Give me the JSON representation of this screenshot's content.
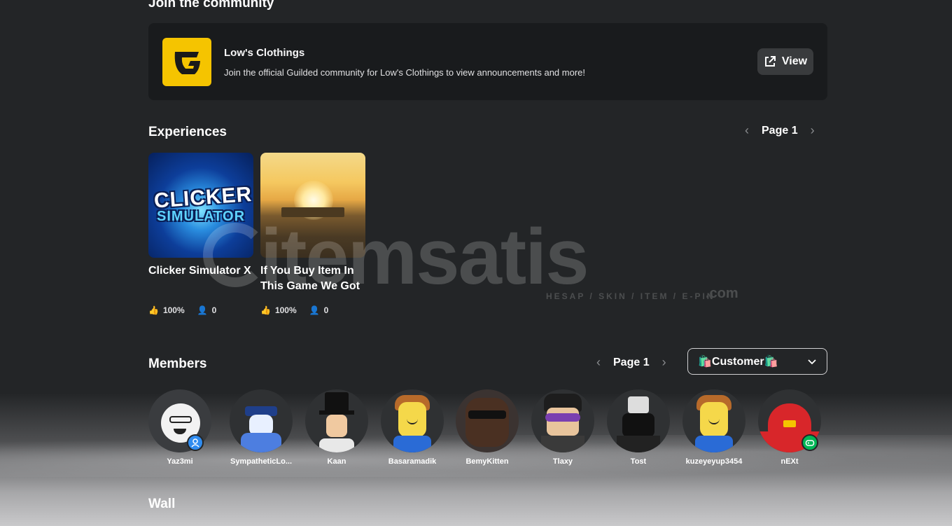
{
  "community": {
    "section_title": "Join the community",
    "name": "Low's Clothings",
    "description": "Join the official Guilded community for Low's Clothings to view announcements and more!",
    "view_label": "View"
  },
  "experiences": {
    "section_title": "Experiences",
    "page_label": "Page 1",
    "items": [
      {
        "title": "Clicker Simulator X",
        "like_ratio": "100%",
        "players": "0",
        "thumb_line1": "CLICKER",
        "thumb_line2": "SIMULATOR"
      },
      {
        "title": "If You Buy Item In This Game We Got",
        "like_ratio": "100%",
        "players": "0"
      }
    ]
  },
  "members": {
    "section_title": "Members",
    "page_label": "Page 1",
    "role_dropdown": "🛍️Customer🛍️",
    "items": [
      {
        "name": "Yaz3mi",
        "badge": "user"
      },
      {
        "name": "SympatheticLo..."
      },
      {
        "name": "Kaan"
      },
      {
        "name": "Basaramadik"
      },
      {
        "name": "BemyKitten"
      },
      {
        "name": "Tlaxy"
      },
      {
        "name": "Tost"
      },
      {
        "name": "kuzeyeyup3454"
      },
      {
        "name": "nEXt",
        "badge": "game"
      }
    ]
  },
  "wall": {
    "section_title": "Wall"
  },
  "watermark": {
    "brand": "itemsatis",
    "tagline": "HESAP / SKIN / ITEM / E-PIN",
    "suffix": ".com"
  },
  "colors": {
    "background": "#232527",
    "card": "#191b1d",
    "guilded_yellow": "#f5c400",
    "button": "#393b3d"
  }
}
